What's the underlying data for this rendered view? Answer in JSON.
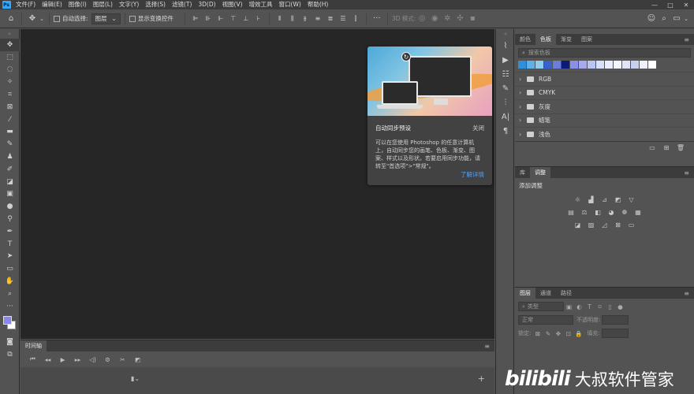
{
  "menubar": {
    "logo": "Ps",
    "items": [
      "文件(F)",
      "编辑(E)",
      "图像(I)",
      "图层(L)",
      "文字(Y)",
      "选择(S)",
      "滤镜(T)",
      "3D(D)",
      "视图(V)",
      "增效工具",
      "窗口(W)",
      "帮助(H)"
    ],
    "window_controls": [
      "—",
      "□",
      "✕"
    ]
  },
  "optbar": {
    "auto_select_label": "自动选择:",
    "layer_dropdown": "图层",
    "show_transform_label": "显示变换控件",
    "mode_3d_label": "3D 模式:",
    "more": "···"
  },
  "popup": {
    "title": "自动同步预设",
    "close_label": "关闭",
    "body": "可以在您使用 Photoshop 的任意计算机上，自动同步您的画笔、色板、渐变、图案、样式以及形状。若要启用同步功能，请转至\"首选项\">\"常规\"。",
    "link": "了解详情"
  },
  "timeline": {
    "tab": "时间轴"
  },
  "swatches_panel": {
    "tabs": [
      "颜色",
      "色板",
      "渐变",
      "图案"
    ],
    "active_tab": 1,
    "search_placeholder": "搜索色板",
    "colors": [
      "#2f8fd8",
      "#5eb0e8",
      "#8fcbee",
      "#3a5fcf",
      "#6a7ed8",
      "#0c1a78",
      "#8890e8",
      "#a8a8f0",
      "#b8c4f4",
      "#d8e0fa",
      "#e8eefc",
      "#f4f6fe",
      "#dfe4f8",
      "#c8d0f0",
      "#eef0fb",
      "#ffffff"
    ],
    "folders": [
      "RGB",
      "CMYK",
      "灰度",
      "蜡笔",
      "浅色"
    ]
  },
  "adjustments_panel": {
    "tabs": [
      "库",
      "调整"
    ],
    "active_tab": 1,
    "title": "添加调整"
  },
  "layers_panel": {
    "tabs": [
      "图层",
      "通道",
      "路径"
    ],
    "active_tab": 0,
    "filter_placeholder": "类型",
    "blend_mode": "正常",
    "opacity_label": "不透明度:",
    "lock_label": "锁定:",
    "fill_label": "填充:"
  },
  "watermark": {
    "logo": "bilibili",
    "text": "大叔软件管家"
  }
}
